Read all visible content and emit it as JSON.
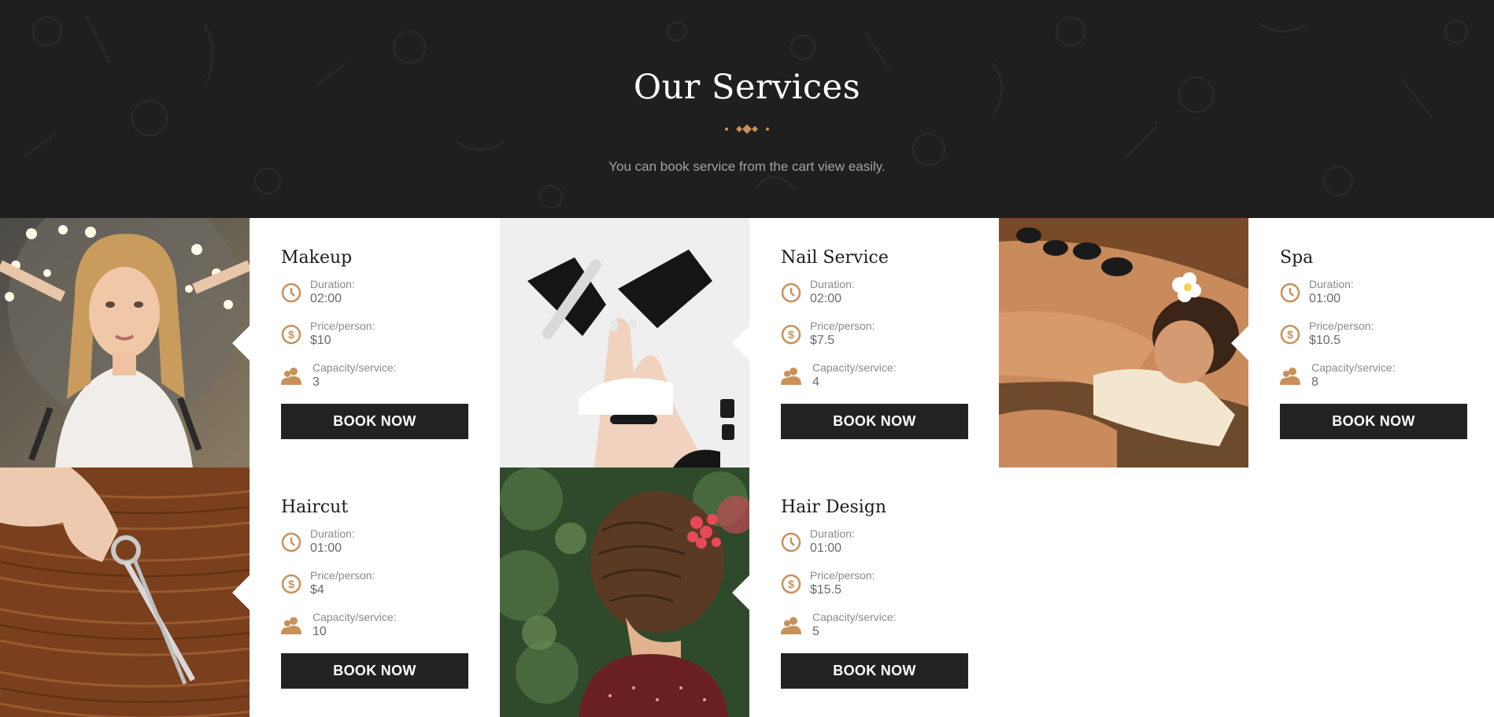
{
  "header": {
    "title": "Our Services",
    "subtitle": "You can book service from the cart view easily."
  },
  "labels": {
    "duration": "Duration:",
    "price": "Price/person:",
    "capacity": "Capacity/service:",
    "book": "BOOK NOW"
  },
  "colors": {
    "accent": "#c8915a",
    "dark": "#1f1f1f",
    "button": "#222222"
  },
  "icons": [
    "clock-icon",
    "dollar-icon",
    "users-icon",
    "diamond-divider-icon"
  ],
  "services": [
    {
      "name": "Makeup",
      "duration": "02:00",
      "price": "$10",
      "capacity": "3",
      "image": "makeup-photo"
    },
    {
      "name": "Nail Service",
      "duration": "02:00",
      "price": "$7.5",
      "capacity": "4",
      "image": "nail-photo"
    },
    {
      "name": "Spa",
      "duration": "01:00",
      "price": "$10.5",
      "capacity": "8",
      "image": "spa-photo"
    },
    {
      "name": "Haircut",
      "duration": "01:00",
      "price": "$4",
      "capacity": "10",
      "image": "haircut-photo"
    },
    {
      "name": "Hair Design",
      "duration": "01:00",
      "price": "$15.5",
      "capacity": "5",
      "image": "hair-design-photo"
    }
  ]
}
